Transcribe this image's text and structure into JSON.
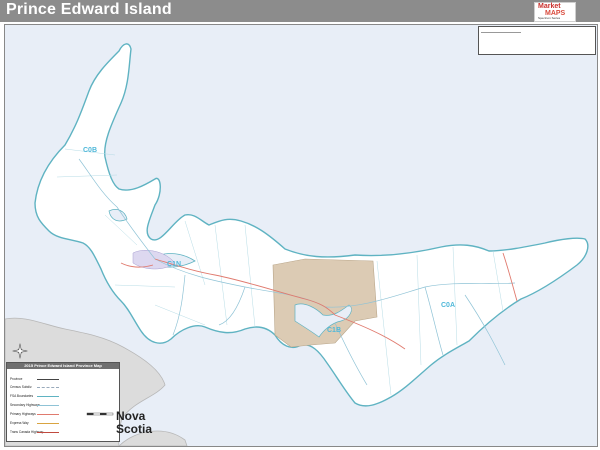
{
  "title": "Prince Edward Island",
  "brand": {
    "line1": "Market",
    "line2": "MAPS",
    "tagline": "Spectrum Series"
  },
  "fsa_labels": {
    "c0b": "C0B",
    "c1n": "C1N",
    "c0a": "C0A",
    "c1b": "C1B"
  },
  "neighbor_label": {
    "line1": "Nova",
    "line2": "Scotia"
  },
  "legend": {
    "title": "2015 Prince Edward Island Province Map",
    "rows": [
      "Province",
      "Census Subdiv.",
      "FSA Boundaries",
      "Secondary Highways",
      "Primary Highways",
      "Express Way",
      "Trans Canada Highway"
    ]
  },
  "colors": {
    "titlebar": "#8c8c8c",
    "land": "#ffffff",
    "water": "#e8eef7",
    "coast": "#5fb3c2",
    "urban": "#dccbb4",
    "highway": "#e07a6e",
    "road": "#8fc3d6",
    "fsa_text": "#4fb8d9"
  },
  "icons": {
    "compass": "compass-rose-icon",
    "scale": "scale-bar-icon"
  }
}
